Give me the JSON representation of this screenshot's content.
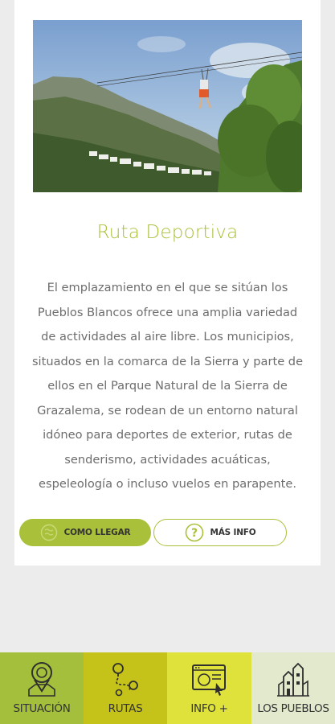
{
  "card": {
    "title": "Ruta Deportiva",
    "description": "El emplazamiento en el que se sitúan los Pueblos Blancos ofrece una amplia variedad de actividades al aire libre. Los municipios, situados en la comarca de la Sierra y parte de ellos en el Parque Natural de la Sierra de Grazalema, se rodean de un entorno natural idóneo para deportes de exterior, rutas de senderismo, actividades acuáticas, espeleología o incluso vuelos en parapente.",
    "hero_image": "zipline-over-mountain-village-photo"
  },
  "buttons": {
    "directions_label": "COMO LLEGAR",
    "directions_icon": "map-icon",
    "more_info_label": "MÁS INFO",
    "more_info_icon": "question-circle-icon"
  },
  "tabbar": {
    "items": [
      {
        "label": "SITUACIÓN",
        "icon": "map-pin-icon",
        "color": "#a4bf3b"
      },
      {
        "label": "RUTAS",
        "icon": "route-icon",
        "color": "#c5c21a"
      },
      {
        "label": "INFO +",
        "icon": "browser-info-icon",
        "color": "#dfe23a"
      },
      {
        "label": "LOS PUEBLOS",
        "icon": "village-icon",
        "color": "#e2e9cc"
      }
    ]
  },
  "colors": {
    "accent": "#a9c13a",
    "text": "#6d6d6d",
    "background": "#ececec"
  }
}
